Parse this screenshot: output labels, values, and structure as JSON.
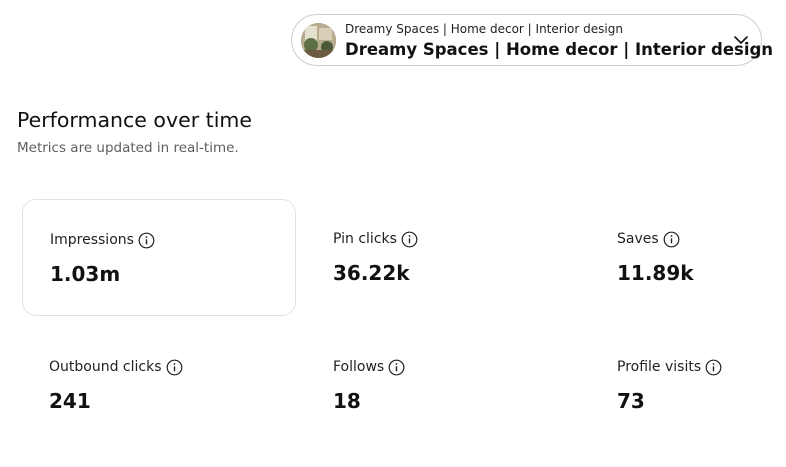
{
  "account": {
    "name_small": "Dreamy Spaces | Home decor | Interior design",
    "name_large": "Dreamy Spaces | Home decor | Interior design"
  },
  "section": {
    "title": "Performance over time",
    "subtitle": "Metrics are updated in real-time."
  },
  "metrics": [
    {
      "label": "Impressions",
      "value": "1.03m",
      "selected": true
    },
    {
      "label": "Pin clicks",
      "value": "36.22k",
      "selected": false
    },
    {
      "label": "Saves",
      "value": "11.89k",
      "selected": false
    },
    {
      "label": "Outbound clicks",
      "value": "241",
      "selected": false
    },
    {
      "label": "Follows",
      "value": "18",
      "selected": false
    },
    {
      "label": "Profile visits",
      "value": "73",
      "selected": false
    }
  ],
  "icons": {
    "info": "info-circle-icon",
    "dropdown": "chevron-down-icon",
    "avatar": "account-avatar"
  },
  "colors": {
    "text_primary": "#111111",
    "text_secondary": "#5f5f5f",
    "border": "#cdcdcd",
    "card_border": "#e2e2e2"
  }
}
